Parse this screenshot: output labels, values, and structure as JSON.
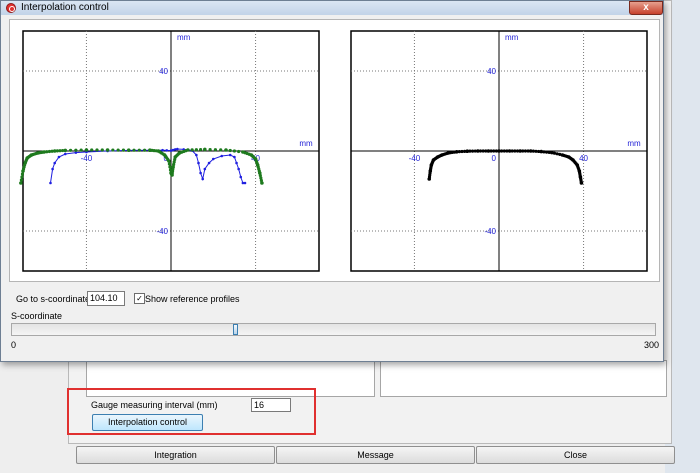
{
  "dialog": {
    "title": "Interpolation control",
    "close_glyph": "x",
    "goto_label": "Go to s-coordinate",
    "goto_value": "104.10",
    "show_reference_label": "Show reference profiles",
    "show_reference_checked": true,
    "s_coordinate_label": "S-coordinate",
    "slider": {
      "min": 0,
      "max": 300,
      "value": 104.1,
      "min_label": "0",
      "max_label": "300"
    }
  },
  "parent": {
    "gauge_label": "Gauge measuring interval (mm)",
    "gauge_value": "16",
    "interpolation_button": "Interpolation control",
    "bottom_buttons": [
      "Integration",
      "Message",
      "Close"
    ]
  },
  "colors": {
    "series_blue": "#1f1fe0",
    "series_green": "#1e7a1e",
    "series_black": "#000000",
    "axis_label": "#1f1fd6",
    "highlight": "#e0302f"
  },
  "chart_data": [
    {
      "type": "scatter",
      "xlabel": "mm",
      "ylabel": "mm",
      "xlim": [
        -70,
        70
      ],
      "ylim": [
        -60,
        60
      ],
      "xticks": [
        -40,
        40
      ],
      "yticks": [
        40,
        -40
      ],
      "tick_labels": {
        "x": [
          "-40",
          "40"
        ],
        "y": [
          "40",
          "-40"
        ],
        "origin": "0"
      },
      "grid": true,
      "series": [
        {
          "color": "#1f1fe0",
          "style": "line+markers",
          "x": [
            -57,
            -56,
            -55,
            -53,
            -50,
            -45,
            -40,
            -30,
            -20,
            -10,
            -4,
            -2,
            0,
            1,
            2,
            3,
            6,
            10,
            12,
            13,
            14,
            15,
            16,
            18,
            20,
            24,
            28,
            30,
            31,
            32,
            33,
            34,
            35
          ],
          "y": [
            -16,
            -9,
            -6,
            -3,
            -1.5,
            -0.8,
            -0.5,
            0,
            0.3,
            0.4,
            0.4,
            0.3,
            0.2,
            0.5,
            0.8,
            1,
            0.8,
            0.2,
            -2,
            -6,
            -11,
            -14,
            -9,
            -6,
            -4,
            -2.5,
            -2,
            -3,
            -6,
            -9,
            -13,
            -16,
            -16
          ]
        },
        {
          "color": "#1e7a1e",
          "style": "markers",
          "x": [
            -71,
            -70,
            -69,
            -68,
            -66,
            -63,
            -60,
            -55,
            -50,
            -40,
            -30,
            -20,
            -10,
            -6,
            -3,
            -1,
            0,
            0.5,
            1,
            2,
            4,
            8,
            16,
            26,
            34,
            38,
            40,
            41,
            42,
            43
          ],
          "y": [
            -16,
            -10,
            -6,
            -3.5,
            -2,
            -1,
            -0.5,
            0,
            0.3,
            0.5,
            0.5,
            0.4,
            0.4,
            0,
            -2,
            -5,
            -11,
            -12,
            -8,
            -3,
            -1,
            0.5,
            0.8,
            0.5,
            -0.5,
            -2,
            -4,
            -7,
            -11,
            -16
          ]
        }
      ]
    },
    {
      "type": "scatter",
      "xlabel": "mm",
      "ylabel": "mm",
      "xlim": [
        -70,
        70
      ],
      "ylim": [
        -60,
        60
      ],
      "xticks": [
        -40,
        40
      ],
      "yticks": [
        40,
        -40
      ],
      "tick_labels": {
        "x": [
          "-40",
          "40"
        ],
        "y": [
          "40",
          "-40"
        ],
        "origin": "0"
      },
      "grid": true,
      "series": [
        {
          "color": "#000000",
          "style": "markers",
          "x": [
            -33,
            -32.5,
            -32,
            -31,
            -29,
            -27,
            -24,
            -20,
            -15,
            -10,
            -5,
            0,
            5,
            10,
            15,
            20,
            25,
            30,
            33,
            35,
            37,
            38,
            38.5,
            39
          ],
          "y": [
            -14,
            -10,
            -7,
            -4.5,
            -3,
            -2,
            -1,
            -0.4,
            -0.1,
            0,
            0,
            0,
            0,
            0,
            0,
            -0.3,
            -0.8,
            -2,
            -3,
            -4.5,
            -7,
            -10,
            -13,
            -16
          ]
        }
      ]
    }
  ]
}
